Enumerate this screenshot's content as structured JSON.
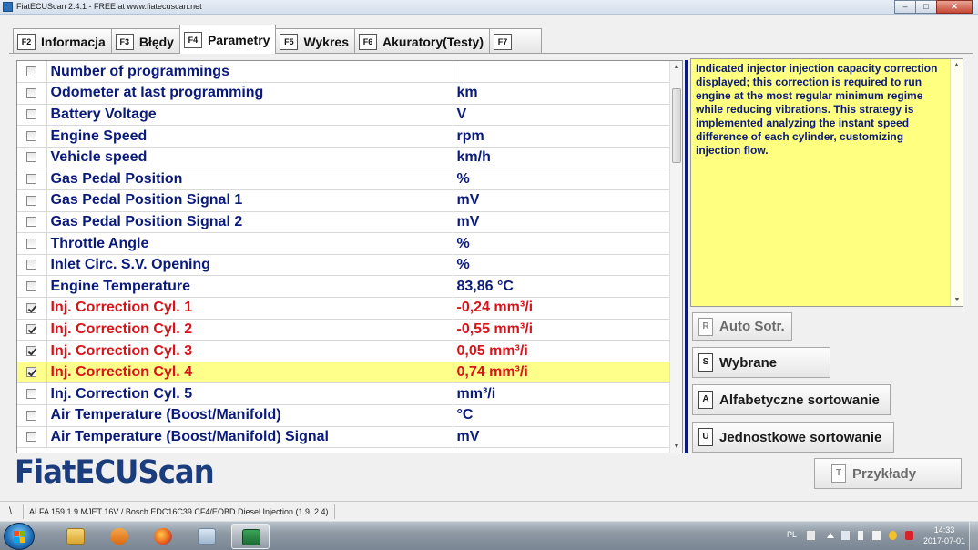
{
  "window": {
    "title": "FiatECUScan 2.4.1 - FREE at www.fiatecuscan.net"
  },
  "tabs": [
    {
      "key": "F2",
      "label": "Informacja"
    },
    {
      "key": "F3",
      "label": "Błędy"
    },
    {
      "key": "F4",
      "label": "Parametry",
      "active": true
    },
    {
      "key": "F5",
      "label": "Wykres"
    },
    {
      "key": "F6",
      "label": "Akuratory(Testy)"
    },
    {
      "key": "F7",
      "label": ""
    }
  ],
  "params": [
    {
      "name": "Number of programmings",
      "value": "",
      "checked": false
    },
    {
      "name": "Odometer at last programming",
      "value": "km",
      "checked": false
    },
    {
      "name": "Battery Voltage",
      "value": "V",
      "checked": false
    },
    {
      "name": "Engine Speed",
      "value": "rpm",
      "checked": false
    },
    {
      "name": "Vehicle speed",
      "value": "km/h",
      "checked": false
    },
    {
      "name": "Gas Pedal Position",
      "value": "%",
      "checked": false
    },
    {
      "name": "Gas Pedal Position Signal 1",
      "value": "mV",
      "checked": false
    },
    {
      "name": "Gas Pedal Position Signal 2",
      "value": "mV",
      "checked": false
    },
    {
      "name": "Throttle Angle",
      "value": "%",
      "checked": false
    },
    {
      "name": "Inlet Circ. S.V. Opening",
      "value": "%",
      "checked": false
    },
    {
      "name": "Engine Temperature",
      "value": "83,86 °C",
      "checked": false
    },
    {
      "name": "Inj. Correction Cyl. 1",
      "value": "-0,24 mm³/i",
      "checked": true
    },
    {
      "name": "Inj. Correction Cyl. 2",
      "value": "-0,55 mm³/i",
      "checked": true
    },
    {
      "name": "Inj. Correction Cyl. 3",
      "value": "0,05 mm³/i",
      "checked": true
    },
    {
      "name": "Inj. Correction Cyl. 4",
      "value": "0,74 mm³/i",
      "checked": true,
      "highlighted": true
    },
    {
      "name": "Inj. Correction Cyl. 5",
      "value": "mm³/i",
      "checked": false
    },
    {
      "name": "Air Temperature (Boost/Manifold)",
      "value": "°C",
      "checked": false
    },
    {
      "name": "Air Temperature (Boost/Manifold) Signal",
      "value": "mV",
      "checked": false
    }
  ],
  "description": "Indicated injector injection capacity correction displayed; this correction is required to run engine at the most regular minimum regime while reducing vibrations. This strategy is implemented analyzing the instant speed difference of each cylinder, customizing injection flow.",
  "side_buttons": {
    "auto": {
      "key": "R",
      "label": "Auto Sotr."
    },
    "selected": {
      "key": "S",
      "label": "Wybrane"
    },
    "alpha": {
      "key": "A",
      "label": "Alfabetyczne sortowanie"
    },
    "unit": {
      "key": "U",
      "label": "Jednostkowe sortowanie"
    },
    "examples": {
      "key": "T",
      "label": "Przykłady"
    }
  },
  "logo": "FiatECUScan",
  "status": {
    "indicator": "\\",
    "vehicle": "ALFA 159 1.9 MJET 16V / Bosch EDC16C39 CF4/EOBD Diesel Injection (1.9, 2.4)"
  },
  "taskbar": {
    "language": "PL",
    "time": "14:33",
    "date": "2017-07-01"
  },
  "colors": {
    "navy_text": "#0a1a7a",
    "selected_text": "#d8131a",
    "row_highlight": "#fefe8a",
    "description_bg": "#ffff80",
    "logo": "#1b3c7d"
  }
}
